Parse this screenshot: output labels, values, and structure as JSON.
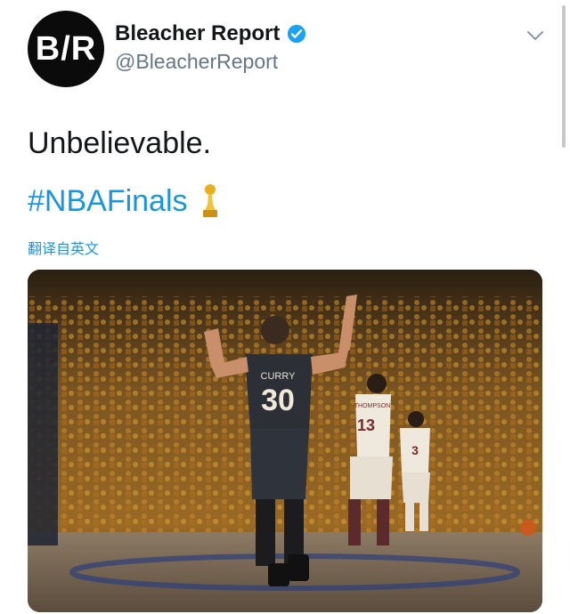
{
  "account": {
    "avatar_text": "B/R",
    "name": "Bleacher Report",
    "handle": "@BleacherReport",
    "verified_icon": "verified-badge-icon",
    "verified_color": "#1da1f2"
  },
  "menu": {
    "icon": "chevron-down-icon"
  },
  "tweet": {
    "text": "Unbelievable.",
    "hashtag": "#NBAFinals",
    "emoji_icon": "trophy-icon",
    "translate_label": "翻译自英文",
    "link_color": "#1b95e0"
  },
  "media": {
    "description_icon": "photo",
    "jersey_main_name": "CURRY",
    "jersey_main_number": "30",
    "jersey_right1_name": "THOMPSON",
    "jersey_right1_number": "13",
    "jersey_right2_number": "3"
  }
}
